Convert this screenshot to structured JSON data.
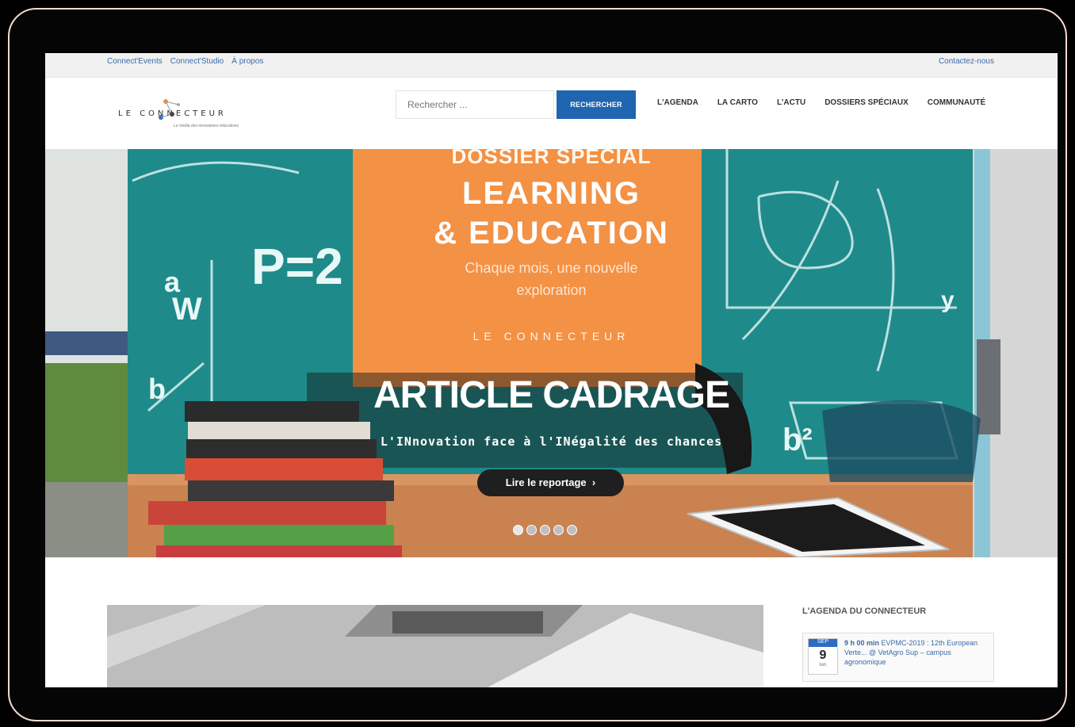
{
  "topbar": {
    "links": [
      "Connect'Events",
      "Connect'Studio",
      "À propos"
    ],
    "contact": "Contactez-nous"
  },
  "header": {
    "logo_text": "LE CONNECTEUR",
    "logo_tagline": "Le média des innovations éducatives",
    "search_placeholder": "Rechercher ...",
    "search_button": "RECHERCHER",
    "nav": [
      "L'AGENDA",
      "LA CARTO",
      "L'ACTU",
      "DOSSIERS SPÉCIAUX",
      "COMMUNAUTÉ"
    ]
  },
  "hero": {
    "dossier": "DOSSIER SPECIAL",
    "learning": "LEARNING",
    "education": "& EDUCATION",
    "chaque_line1": "Chaque mois, une nouvelle",
    "chaque_line2": "exploration",
    "inner_logo": "LE CONNECTEUR",
    "cadrage": "ARTICLE CADRAGE",
    "innov": "L'INnovation face à l'INégalité des chances",
    "cta": "Lire le reportage",
    "slides": 5,
    "active_slide": 1,
    "colors": {
      "orange": "#f39145",
      "chalkboard": "#1f8a8a",
      "table": "#c98250"
    }
  },
  "sidebar": {
    "agenda_title": "L'AGENDA DU CONNECTEUR",
    "event": {
      "month": "SEP",
      "day": "9",
      "weekday": "lun",
      "time": "9 h 00 min",
      "title": "EVPMC-2019 : 12th European Verte... @ VetAgro Sup – campus agronomique"
    }
  }
}
